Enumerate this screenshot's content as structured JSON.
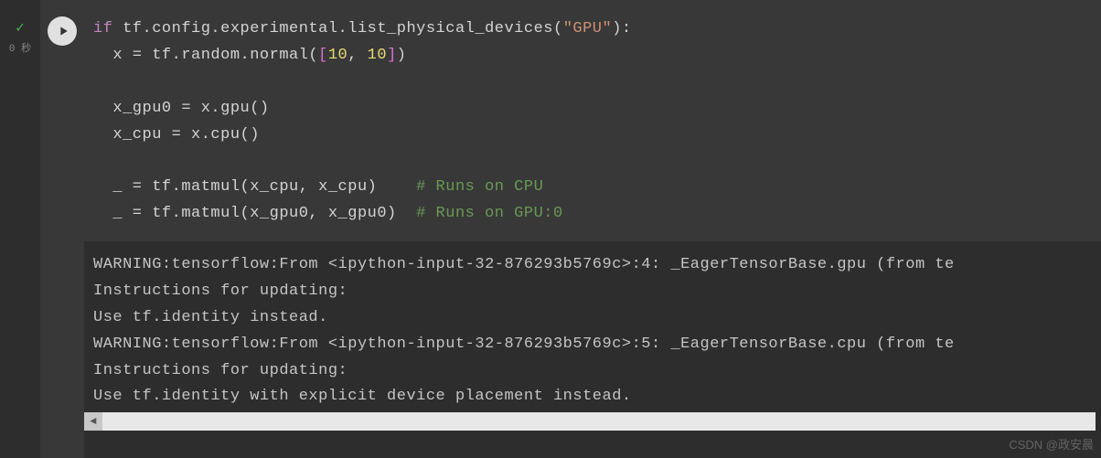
{
  "gutter": {
    "exec_time": "0 秒"
  },
  "code": {
    "line1": {
      "kw": "if",
      "expr": " tf.config.experimental.list_physical_devices(",
      "str": "\"GPU\"",
      "end": "):"
    },
    "line2": {
      "indent": "  x = tf.random.normal(",
      "nums": "[10, 10]",
      "end": ")"
    },
    "line3": "",
    "line4": "  x_gpu0 = x.gpu()",
    "line5": "  x_cpu = x.cpu()",
    "line6": "",
    "line7": {
      "code": "  _ = tf.matmul(x_cpu, x_cpu)    ",
      "comment": "# Runs on CPU"
    },
    "line8": {
      "code": "  _ = tf.matmul(x_gpu0, x_gpu0)  ",
      "comment": "# Runs on GPU:0"
    }
  },
  "output": {
    "line1": "WARNING:tensorflow:From <ipython-input-32-876293b5769c>:4: _EagerTensorBase.gpu (from te",
    "line2": "Instructions for updating:",
    "line3": "Use tf.identity instead.",
    "line4": "WARNING:tensorflow:From <ipython-input-32-876293b5769c>:5: _EagerTensorBase.cpu (from te",
    "line5": "Instructions for updating:",
    "line6": "Use tf.identity with explicit device placement instead."
  },
  "watermark": "CSDN @政安晨"
}
